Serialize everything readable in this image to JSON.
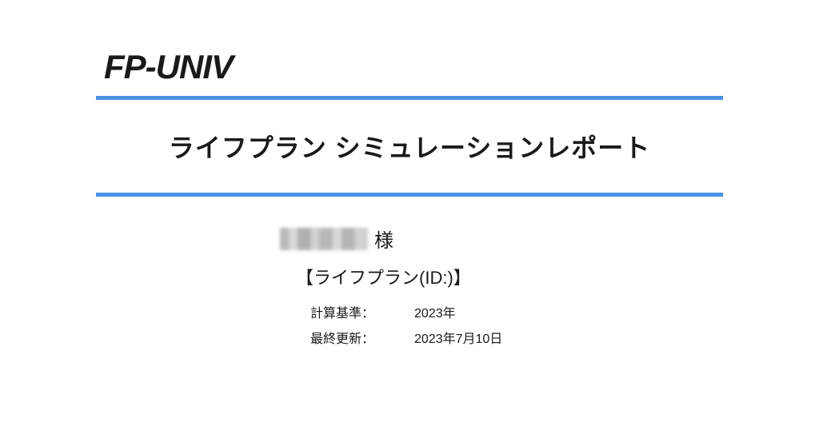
{
  "header": {
    "logo": "FP-UNIV"
  },
  "report": {
    "title": "ライフプラン シミュレーションレポート"
  },
  "client": {
    "honorific": "様",
    "plan_id_prefix": "【ライフプラン(ID:",
    "plan_id_value": "",
    "plan_id_suffix": ")】"
  },
  "meta": {
    "calc_basis_label": "計算基準：",
    "calc_basis_value": "2023年",
    "last_updated_label": "最終更新：",
    "last_updated_value": "2023年7月10日"
  }
}
